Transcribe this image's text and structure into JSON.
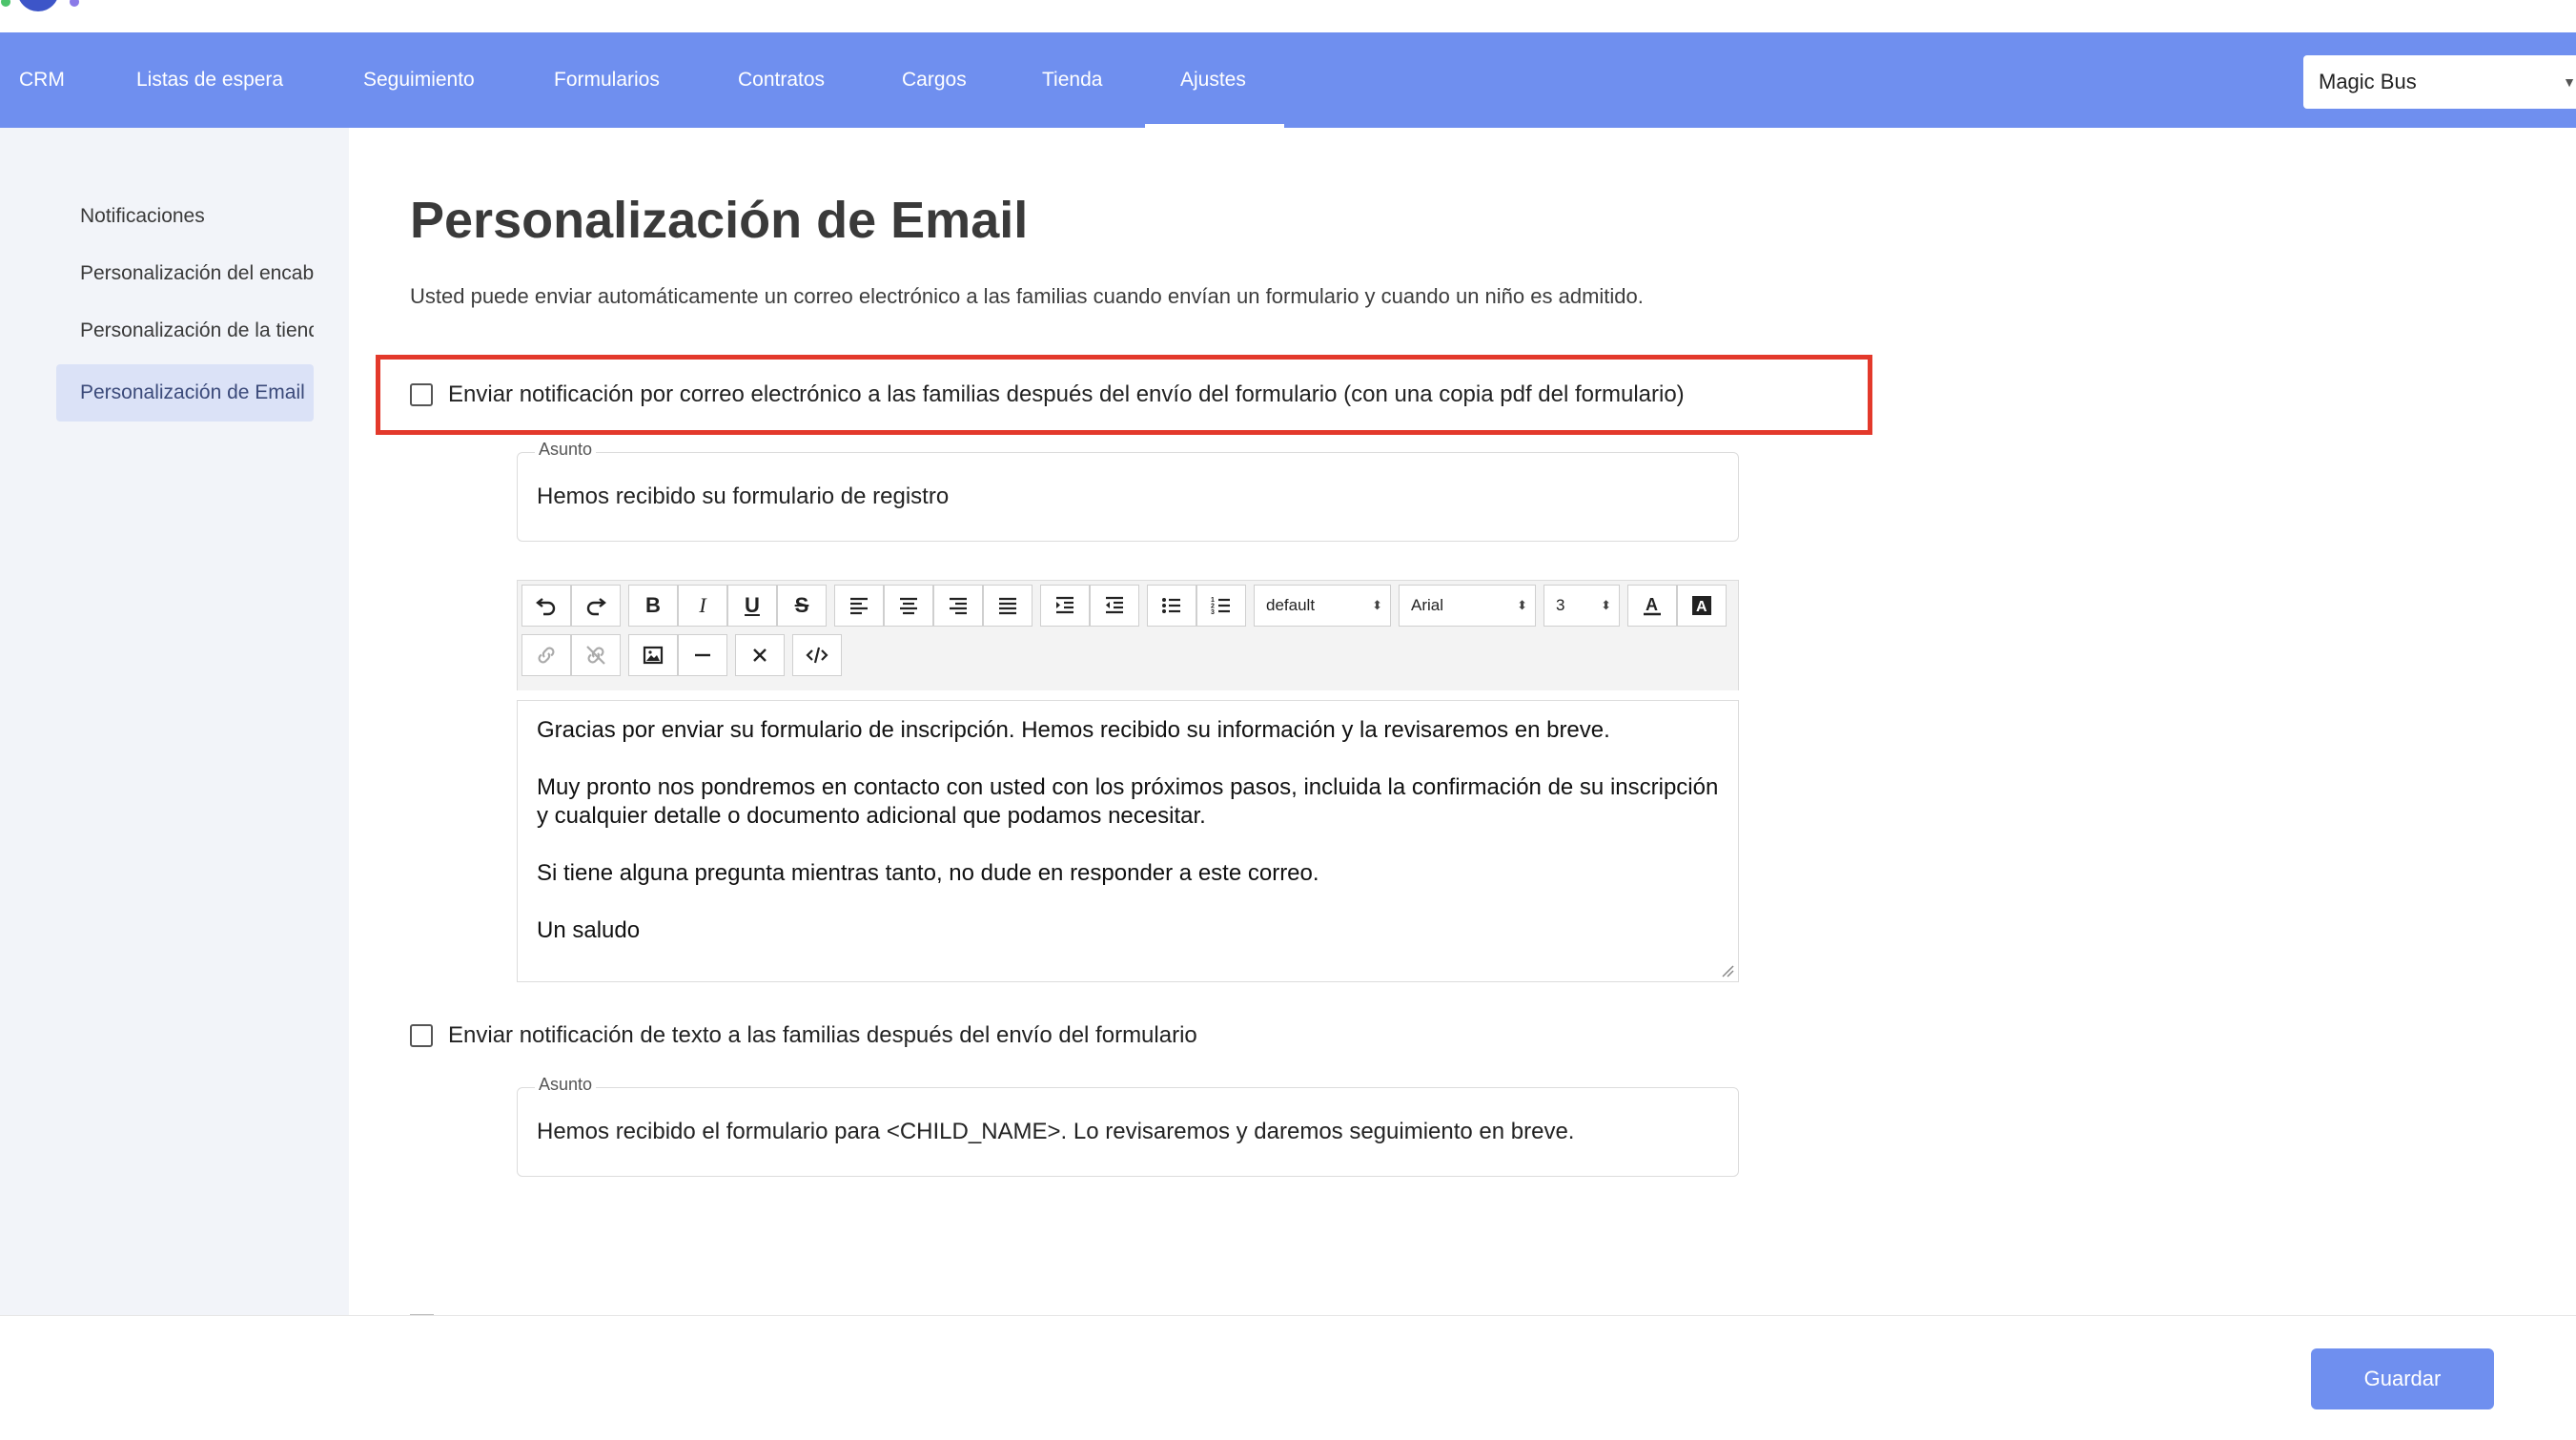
{
  "nav": {
    "items": [
      {
        "label": "CRM"
      },
      {
        "label": "Listas de espera"
      },
      {
        "label": "Seguimiento"
      },
      {
        "label": "Formularios"
      },
      {
        "label": "Contratos"
      },
      {
        "label": "Cargos"
      },
      {
        "label": "Tienda"
      },
      {
        "label": "Ajustes",
        "active": true
      }
    ],
    "school_select": {
      "value": "Magic Bus"
    }
  },
  "sidebar": {
    "items": [
      {
        "label": "Notificaciones"
      },
      {
        "label": "Personalización del encabezado"
      },
      {
        "label": "Personalización de la tienda"
      },
      {
        "label": "Personalización de Email",
        "active": true
      }
    ]
  },
  "main": {
    "title": "Personalización de Email",
    "description": "Usted puede enviar automáticamente un correo electrónico a las familias cuando envían un formulario y cuando un niño es admitido.",
    "email_notification": {
      "checkbox_label": "Enviar notificación por correo electrónico a las familias después del envío del formulario (con una copia pdf del formulario)",
      "checked": false,
      "subject_label": "Asunto",
      "subject_value": "Hemos recibido su formulario de registro",
      "toolbar": {
        "font_size_select": "default",
        "font_family_select": "Arial",
        "line_height_select": "3"
      },
      "body": [
        "Gracias por enviar su formulario de inscripción. Hemos recibido su información y la revisaremos en breve.",
        "Muy pronto nos pondremos en contacto con usted con los próximos pasos, incluida la confirmación de su inscripción y cualquier detalle o documento adicional que podamos necesitar.",
        "Si tiene alguna pregunta mientras tanto, no dude en responder a este correo.",
        "Un saludo"
      ]
    },
    "text_notification": {
      "checkbox_label": "Enviar notificación de texto a las familias después del envío del formulario",
      "checked": false,
      "subject_label": "Asunto",
      "subject_value": "Hemos recibido el formulario para <CHILD_NAME>. Lo revisaremos y daremos seguimiento en breve."
    }
  },
  "footer": {
    "save_label": "Guardar"
  },
  "colors": {
    "nav_bg": "#6f8fef",
    "sidebar_bg": "#f2f4f9",
    "sidebar_active_bg": "#dbe2f7",
    "highlight_border": "#e3392b",
    "save_button_bg": "#6f8fef"
  }
}
